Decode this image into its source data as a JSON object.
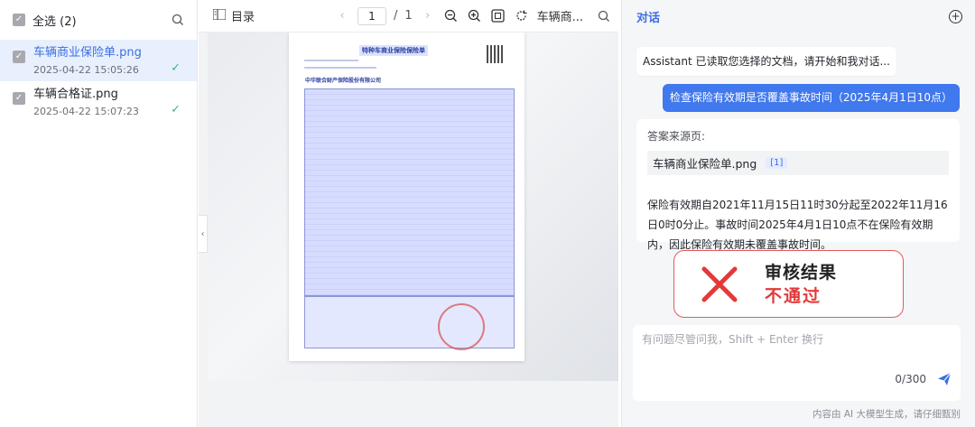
{
  "sidebar": {
    "select_all_label": "全选 (2)",
    "files": [
      {
        "name": "车辆商业保险单.png",
        "date": "2025-04-22 15:05:26",
        "selected": true
      },
      {
        "name": "车辆合格证.png",
        "date": "2025-04-22 15:07:23",
        "selected": false
      }
    ]
  },
  "viewer": {
    "toc_label": "目录",
    "page_current": "1",
    "page_sep": "/",
    "page_total": "1",
    "file_short": "车辆商...",
    "doc_title": "特种车商业保险保险单",
    "doc_company": "中华联合财产保险股份有限公司"
  },
  "chat": {
    "title": "对话",
    "assistant_greeting": "Assistant 已读取您选择的文档，请开始和我对话...",
    "user_question": "检查保险有效期是否覆盖事故时间（2025年4月1日10点）",
    "answer_source_label": "答案来源页:",
    "answer_source_file": "车辆商业保险单.png",
    "answer_source_ref": "[1]",
    "answer_text": "保险有效期自2021年11月15日11时30分起至2022年11月16日0时0分止。事故时间2025年4月1日10点不在保险有效期内，因此保险有效期未覆盖事故时间。",
    "verdict_title": "审核结果",
    "verdict_result": "不通过",
    "input_placeholder": "有问题尽管问我，Shift + Enter 换行",
    "char_count": "0/300",
    "footnote": "内容由 AI 大模型生成，请仔细甄别"
  },
  "colors": {
    "accent": "#4078ed",
    "success": "#3db676",
    "danger": "#e23a3a"
  }
}
